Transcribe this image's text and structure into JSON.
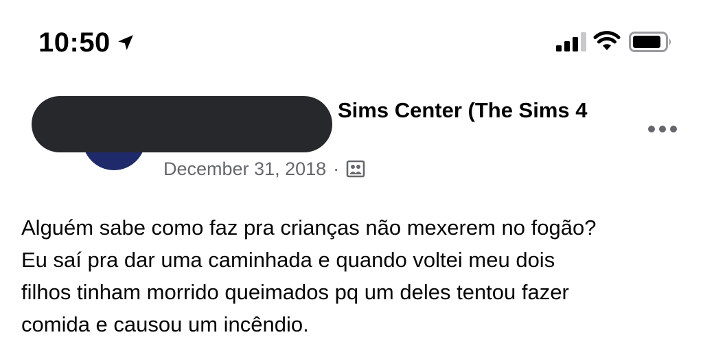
{
  "status_bar": {
    "time": "10:50",
    "icons": [
      "location-arrow-icon",
      "cellular-signal-icon",
      "wifi-icon",
      "battery-icon"
    ]
  },
  "post": {
    "group_name": "Sims Center (The Sims 4",
    "date": "December 31, 2018",
    "separator": "·",
    "audience_icon": "photo-audience-icon",
    "more_icon": "more-horizontal-icon",
    "body_lines": [
      "Alguém sabe como faz pra crianças não mexerem no fogão?",
      "Eu saí pra dar uma caminhada e quando voltei meu dois",
      "filhos tinham morrido queimados pq um deles tentou fazer",
      "comida e causou um incêndio."
    ]
  },
  "colors": {
    "text_primary": "#050505",
    "text_secondary": "#65676b",
    "redaction": "#26282b",
    "avatar": "#1f2a6b"
  }
}
